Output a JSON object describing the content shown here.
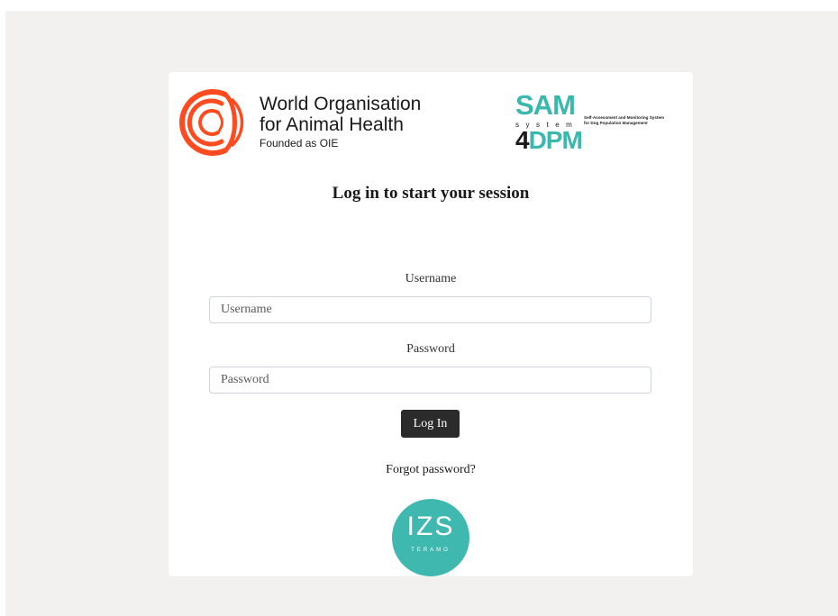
{
  "logos": {
    "woah": {
      "line1": "World Organisation",
      "line2": "for Animal Health",
      "line3": "Founded as OIE",
      "icon": "woah-logo-icon",
      "color": "#ff4b1f"
    },
    "sam": {
      "big": "SAM",
      "system": "system",
      "four": "4",
      "dpm": "DPM",
      "desc_line1": "Self-Assessment and Monitoring System",
      "desc_line2": "for Dog Population Management",
      "color": "#3ab8ad"
    },
    "izs": {
      "main": "IZS",
      "sub": "TERAMO",
      "color": "#3fb8b0"
    }
  },
  "login": {
    "title": "Log in to start your session",
    "username_label": "Username",
    "username_placeholder": "Username",
    "username_value": "",
    "password_label": "Password",
    "password_placeholder": "Password",
    "password_value": "",
    "submit_label": "Log In",
    "forgot_label": "Forgot password?"
  },
  "colors": {
    "background": "#f2f1ef",
    "card": "#ffffff",
    "button": "#2b2b2b"
  }
}
